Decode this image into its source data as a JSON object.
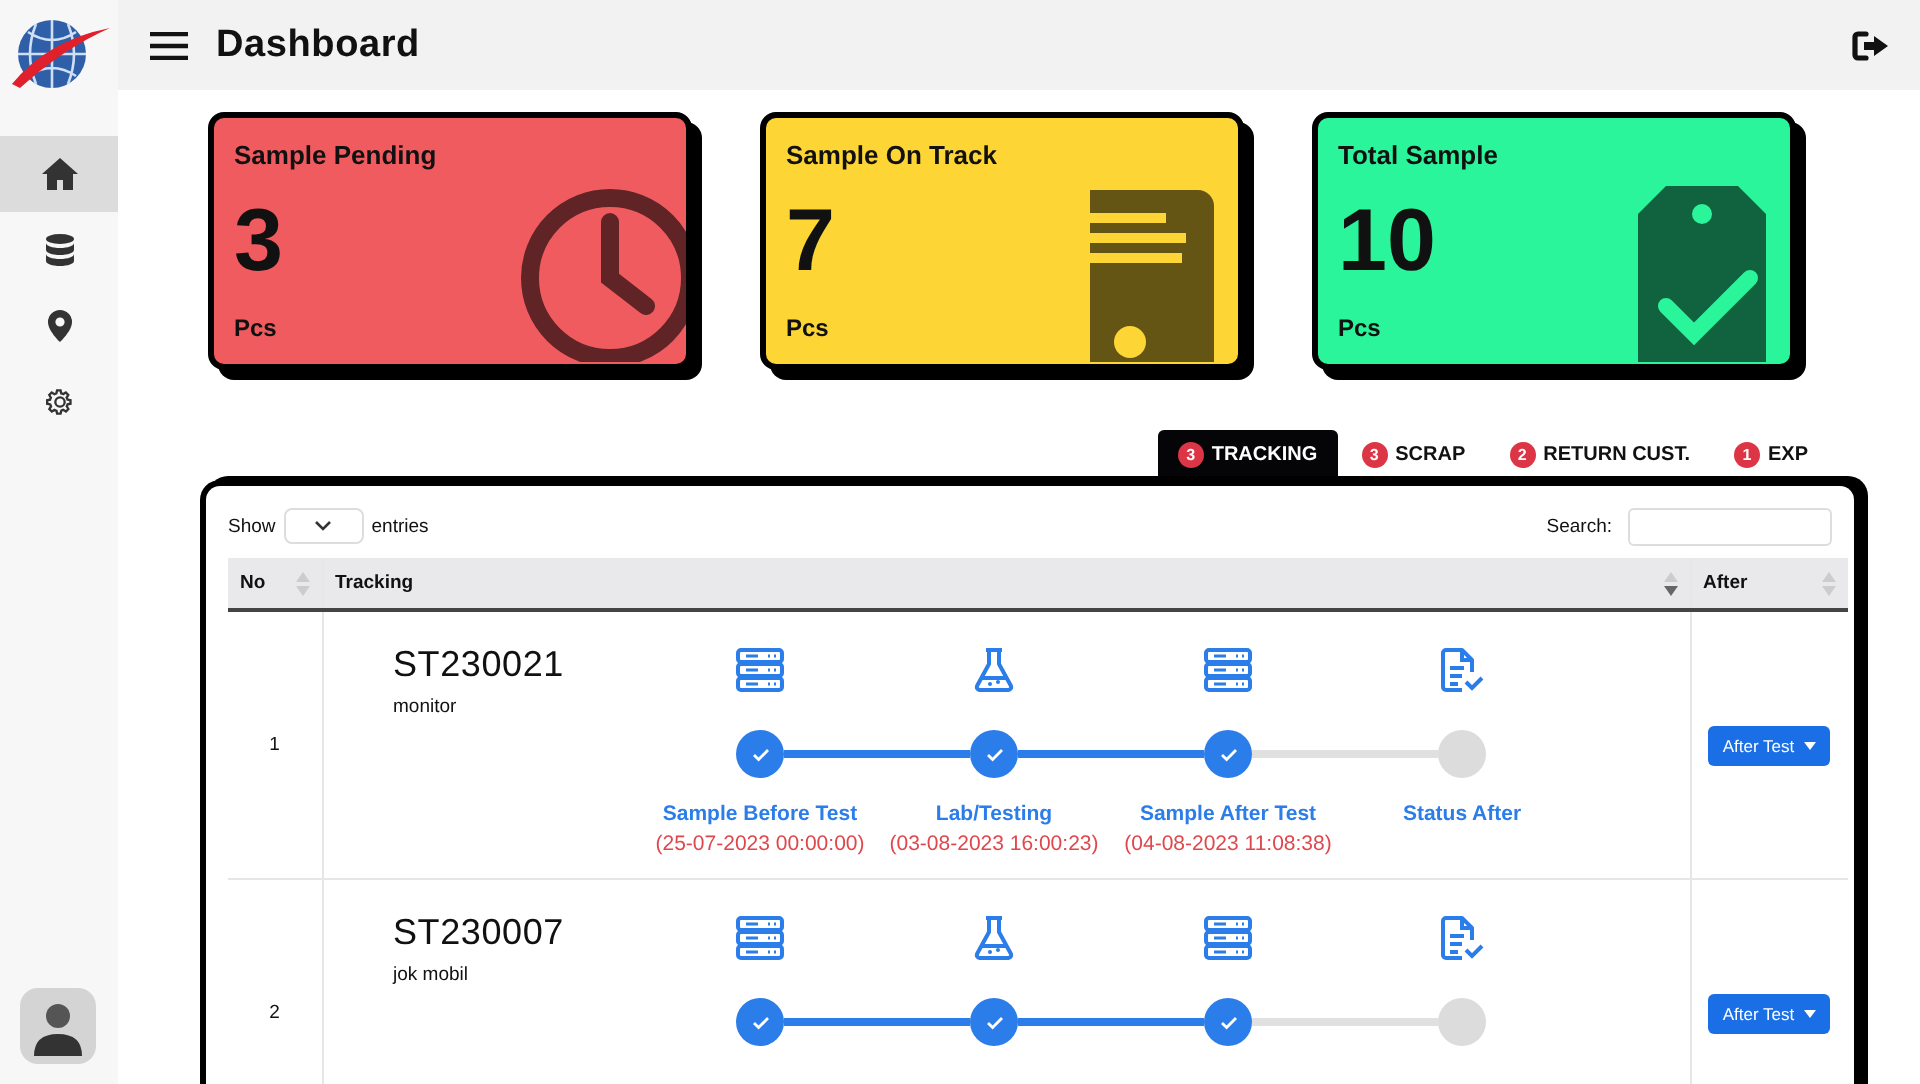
{
  "sidebar": {
    "items": [
      {
        "kind": "home",
        "selected": true
      },
      {
        "kind": "database",
        "selected": false
      },
      {
        "kind": "pin",
        "selected": false
      },
      {
        "kind": "gear",
        "selected": false
      }
    ]
  },
  "header": {
    "title": "Dashboard"
  },
  "cards": [
    {
      "title": "Sample Pending",
      "value": "3",
      "unit": "Pcs",
      "kind": "clock",
      "color": "#f05b5f"
    },
    {
      "title": "Sample On Track",
      "value": "7",
      "unit": "Pcs",
      "kind": "document",
      "color": "#fdd535"
    },
    {
      "title": "Total Sample",
      "value": "10",
      "unit": "Pcs",
      "kind": "tag",
      "color": "#2bf59b"
    }
  ],
  "tabs": [
    {
      "badge": "3",
      "label": "TRACKING",
      "selected": true
    },
    {
      "badge": "3",
      "label": "SCRAP",
      "selected": false
    },
    {
      "badge": "2",
      "label": "RETURN CUST.",
      "selected": false
    },
    {
      "badge": "1",
      "label": "EXP",
      "selected": false
    }
  ],
  "table": {
    "show_label": "Show",
    "entries_label": "entries",
    "search_label": "Search:",
    "columns": [
      {
        "label": "No",
        "sorted": false
      },
      {
        "label": "Tracking",
        "sorted": true
      },
      {
        "label": "After",
        "sorted": false
      }
    ],
    "rows": [
      {
        "no": "1",
        "code": "ST230021",
        "name": "monitor",
        "action": "After Test",
        "steps": [
          {
            "kind": "server",
            "label": "Sample Before Test",
            "date": "(25-07-2023 00:00:00)",
            "done": true
          },
          {
            "kind": "flask",
            "label": "Lab/Testing",
            "date": "(03-08-2023 16:00:23)",
            "done": true
          },
          {
            "kind": "server",
            "label": "Sample After Test",
            "date": "(04-08-2023 11:08:38)",
            "done": true
          },
          {
            "kind": "doc",
            "label": "Status After",
            "done": false
          }
        ]
      },
      {
        "no": "2",
        "code": "ST230007",
        "name": "jok mobil",
        "action": "After Test",
        "steps": [
          {
            "kind": "server",
            "done": true
          },
          {
            "kind": "flask",
            "done": true
          },
          {
            "kind": "server",
            "done": true
          },
          {
            "kind": "doc",
            "done": false
          }
        ]
      }
    ]
  }
}
